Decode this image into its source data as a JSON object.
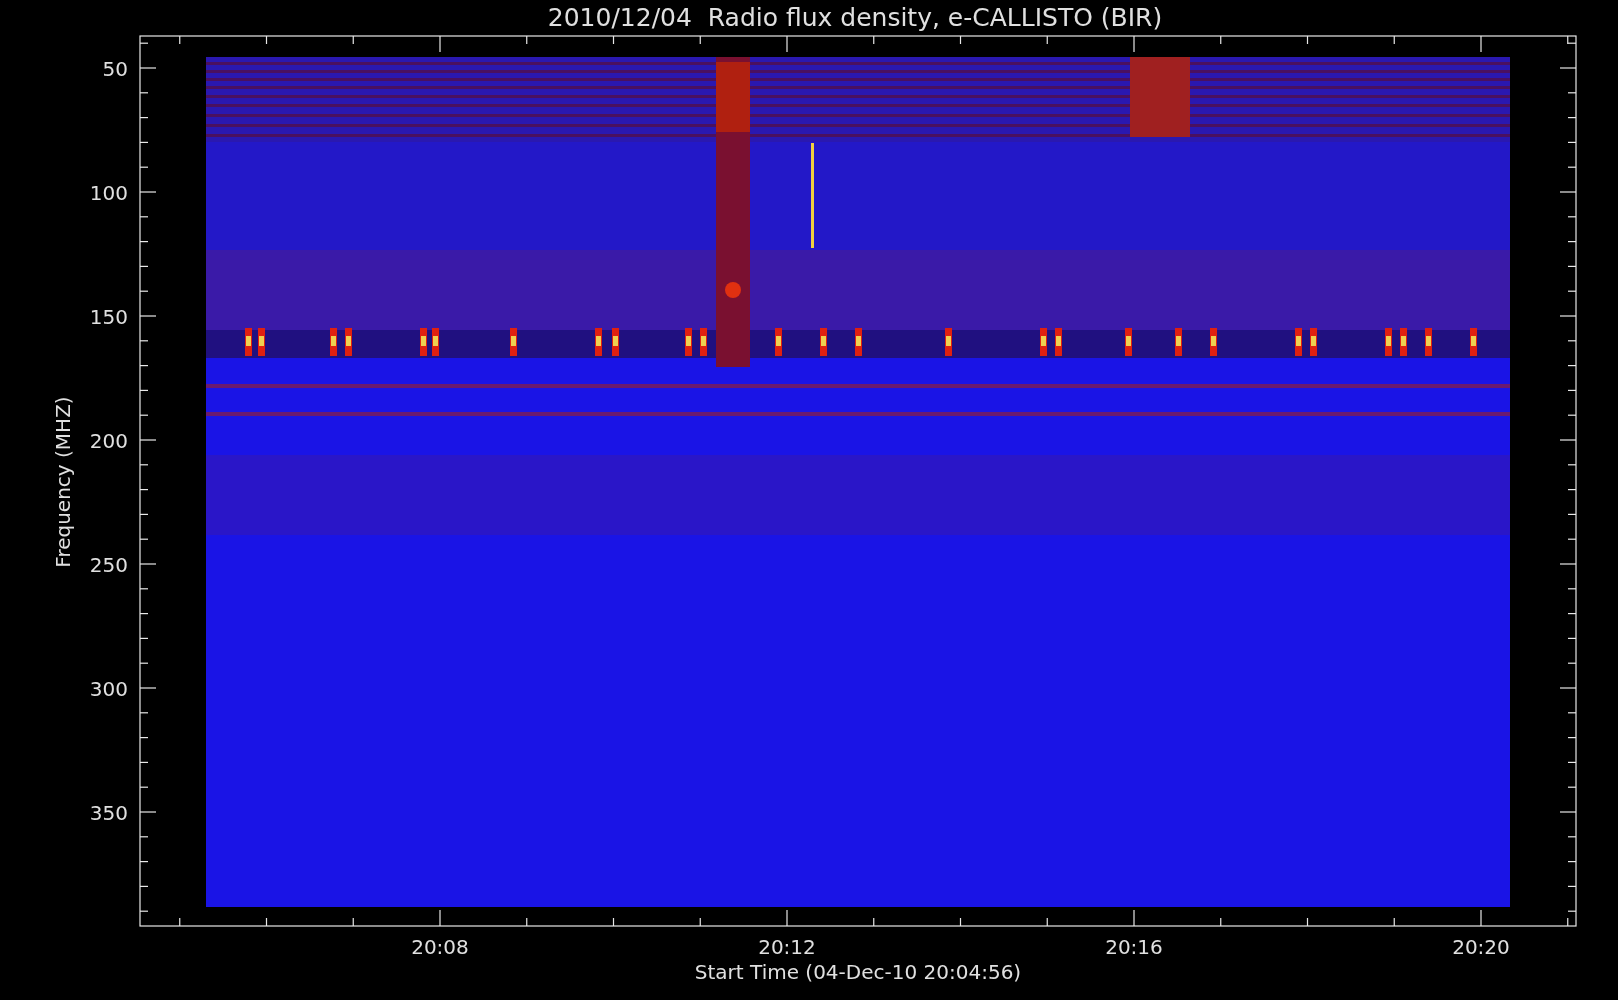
{
  "title": "2010/12/04  Radio flux density, e-CALLISTO (BIR)",
  "y_axis": {
    "label": "Frequency (MHZ)",
    "ticks": [
      "50",
      "100",
      "150",
      "200",
      "250",
      "300",
      "350"
    ]
  },
  "x_axis": {
    "label": "Start Time (04-Dec-10 20:04:56)",
    "ticks": [
      "20:08",
      "20:12",
      "20:16",
      "20:20"
    ]
  }
}
